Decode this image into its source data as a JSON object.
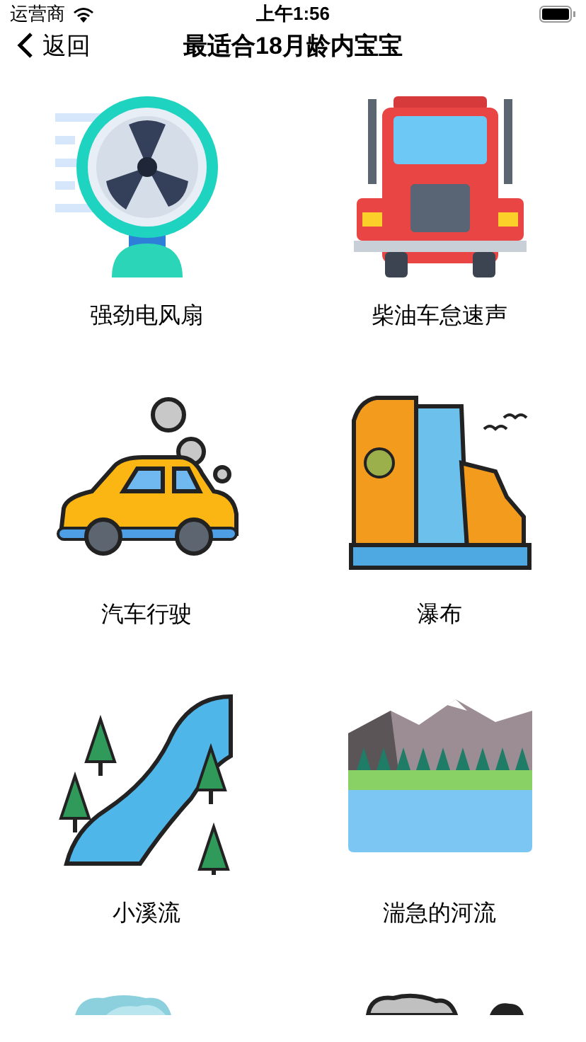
{
  "status_bar": {
    "carrier": "运营商",
    "time": "上午1:56"
  },
  "nav": {
    "back": "返回",
    "title": "最适合18月龄内宝宝"
  },
  "items": [
    {
      "kind": "fan",
      "label": "强劲电风扇"
    },
    {
      "kind": "truck",
      "label": "柴油车怠速声"
    },
    {
      "kind": "car",
      "label": "汽车行驶"
    },
    {
      "kind": "waterfall",
      "label": "瀑布"
    },
    {
      "kind": "stream",
      "label": "小溪流"
    },
    {
      "kind": "river",
      "label": "湍急的河流"
    },
    {
      "kind": "cloud-light"
    },
    {
      "kind": "cloud-dark"
    }
  ]
}
